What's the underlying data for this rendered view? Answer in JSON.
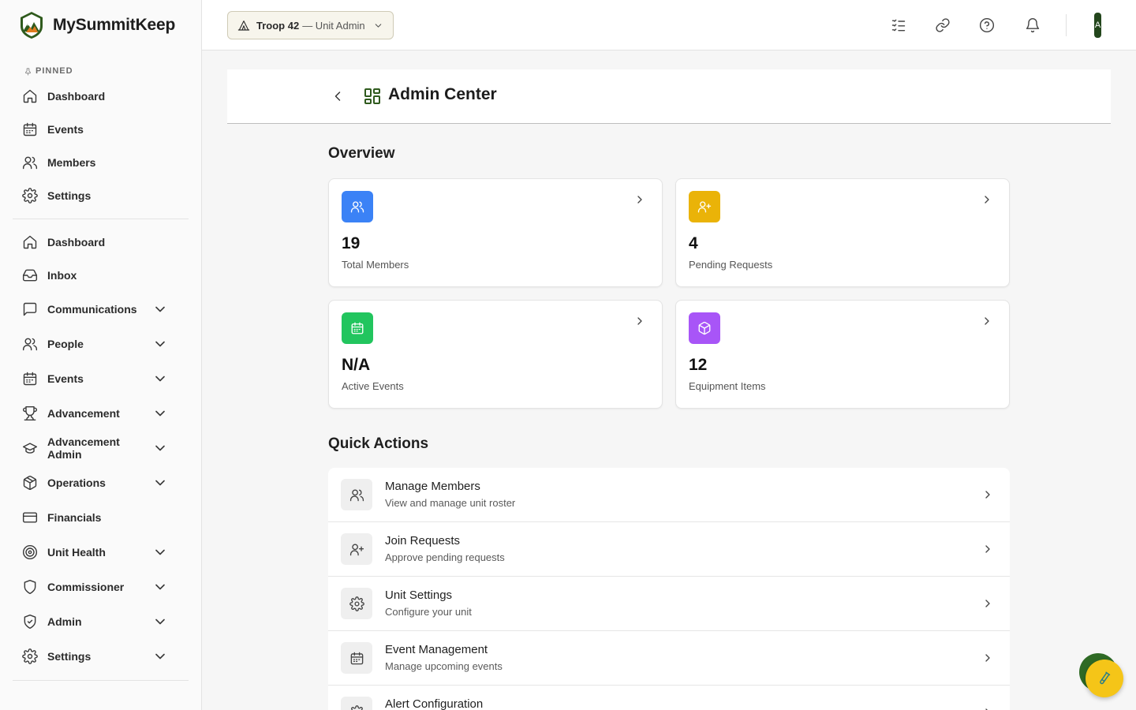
{
  "brand": {
    "name": "MySummitKeep",
    "logo_icon": "mountain-logo-icon"
  },
  "sidebar": {
    "pinned_label": "PINNED",
    "pinned": [
      {
        "label": "Dashboard",
        "icon": "home-icon"
      },
      {
        "label": "Events",
        "icon": "calendar-icon"
      },
      {
        "label": "Members",
        "icon": "users-icon"
      },
      {
        "label": "Settings",
        "icon": "gear-icon"
      }
    ],
    "items": [
      {
        "label": "Dashboard",
        "icon": "home-icon",
        "expandable": false
      },
      {
        "label": "Inbox",
        "icon": "inbox-icon",
        "expandable": false
      },
      {
        "label": "Communications",
        "icon": "message-icon",
        "expandable": true
      },
      {
        "label": "People",
        "icon": "users-icon",
        "expandable": true
      },
      {
        "label": "Events",
        "icon": "calendar-icon",
        "expandable": true
      },
      {
        "label": "Advancement",
        "icon": "trophy-icon",
        "expandable": true
      },
      {
        "label": "Advancement Admin",
        "icon": "graduation-cap-icon",
        "expandable": true
      },
      {
        "label": "Operations",
        "icon": "package-icon",
        "expandable": true
      },
      {
        "label": "Financials",
        "icon": "credit-card-icon",
        "expandable": false
      },
      {
        "label": "Unit Health",
        "icon": "target-icon",
        "expandable": true
      },
      {
        "label": "Commissioner",
        "icon": "shield-icon",
        "expandable": true
      },
      {
        "label": "Admin",
        "icon": "shield-check-icon",
        "expandable": true
      },
      {
        "label": "Settings",
        "icon": "gear-icon",
        "expandable": true
      }
    ]
  },
  "header": {
    "unit_name": "Troop 42",
    "unit_role": "— Unit Admin",
    "icons": [
      "checklist-icon",
      "link-icon",
      "help-icon",
      "bell-icon"
    ],
    "avatar_initial": "A"
  },
  "page": {
    "title": "Admin Center",
    "back_icon": "chevron-left-icon",
    "title_icon": "dashboard-grid-icon"
  },
  "overview": {
    "title": "Overview",
    "cards": [
      {
        "value": "19",
        "label": "Total Members",
        "icon": "users-icon",
        "color": "#3b82f6"
      },
      {
        "value": "4",
        "label": "Pending Requests",
        "icon": "user-plus-icon",
        "color": "#eab308"
      },
      {
        "value": "N/A",
        "label": "Active Events",
        "icon": "calendar-icon",
        "color": "#22c55e"
      },
      {
        "value": "12",
        "label": "Equipment Items",
        "icon": "box-icon",
        "color": "#a855f7"
      }
    ]
  },
  "quick_actions": {
    "title": "Quick Actions",
    "items": [
      {
        "title": "Manage Members",
        "desc": "View and manage unit roster",
        "icon": "users-icon"
      },
      {
        "title": "Join Requests",
        "desc": "Approve pending requests",
        "icon": "user-plus-icon"
      },
      {
        "title": "Unit Settings",
        "desc": "Configure your unit",
        "icon": "gear-icon"
      },
      {
        "title": "Event Management",
        "desc": "Manage upcoming events",
        "icon": "calendar-icon"
      },
      {
        "title": "Alert Configuration",
        "desc": "",
        "icon": "gear-icon"
      }
    ]
  },
  "colors": {
    "brand_green": "#2f5a1d",
    "fab_yellow": "#f5c518",
    "fab_green": "#2f6a25"
  },
  "fab": {
    "icon": "test-tube-icon"
  }
}
